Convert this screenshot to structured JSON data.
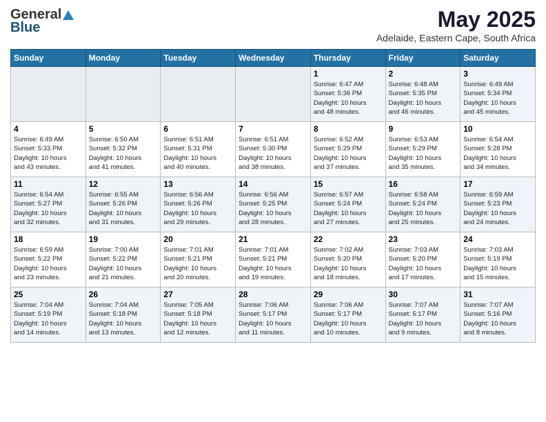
{
  "header": {
    "logo": {
      "general": "General",
      "blue": "Blue",
      "triangle": "▲"
    },
    "title": "May 2025",
    "subtitle": "Adelaide, Eastern Cape, South Africa"
  },
  "weekdays": [
    "Sunday",
    "Monday",
    "Tuesday",
    "Wednesday",
    "Thursday",
    "Friday",
    "Saturday"
  ],
  "weeks": [
    [
      {
        "day": "",
        "info": ""
      },
      {
        "day": "",
        "info": ""
      },
      {
        "day": "",
        "info": ""
      },
      {
        "day": "",
        "info": ""
      },
      {
        "day": "1",
        "info": "Sunrise: 6:47 AM\nSunset: 5:36 PM\nDaylight: 10 hours\nand 48 minutes."
      },
      {
        "day": "2",
        "info": "Sunrise: 6:48 AM\nSunset: 5:35 PM\nDaylight: 10 hours\nand 46 minutes."
      },
      {
        "day": "3",
        "info": "Sunrise: 6:49 AM\nSunset: 5:34 PM\nDaylight: 10 hours\nand 45 minutes."
      }
    ],
    [
      {
        "day": "4",
        "info": "Sunrise: 6:49 AM\nSunset: 5:33 PM\nDaylight: 10 hours\nand 43 minutes."
      },
      {
        "day": "5",
        "info": "Sunrise: 6:50 AM\nSunset: 5:32 PM\nDaylight: 10 hours\nand 41 minutes."
      },
      {
        "day": "6",
        "info": "Sunrise: 6:51 AM\nSunset: 5:31 PM\nDaylight: 10 hours\nand 40 minutes."
      },
      {
        "day": "7",
        "info": "Sunrise: 6:51 AM\nSunset: 5:30 PM\nDaylight: 10 hours\nand 38 minutes."
      },
      {
        "day": "8",
        "info": "Sunrise: 6:52 AM\nSunset: 5:29 PM\nDaylight: 10 hours\nand 37 minutes."
      },
      {
        "day": "9",
        "info": "Sunrise: 6:53 AM\nSunset: 5:29 PM\nDaylight: 10 hours\nand 35 minutes."
      },
      {
        "day": "10",
        "info": "Sunrise: 6:54 AM\nSunset: 5:28 PM\nDaylight: 10 hours\nand 34 minutes."
      }
    ],
    [
      {
        "day": "11",
        "info": "Sunrise: 6:54 AM\nSunset: 5:27 PM\nDaylight: 10 hours\nand 32 minutes."
      },
      {
        "day": "12",
        "info": "Sunrise: 6:55 AM\nSunset: 5:26 PM\nDaylight: 10 hours\nand 31 minutes."
      },
      {
        "day": "13",
        "info": "Sunrise: 6:56 AM\nSunset: 5:26 PM\nDaylight: 10 hours\nand 29 minutes."
      },
      {
        "day": "14",
        "info": "Sunrise: 6:56 AM\nSunset: 5:25 PM\nDaylight: 10 hours\nand 28 minutes."
      },
      {
        "day": "15",
        "info": "Sunrise: 6:57 AM\nSunset: 5:24 PM\nDaylight: 10 hours\nand 27 minutes."
      },
      {
        "day": "16",
        "info": "Sunrise: 6:58 AM\nSunset: 5:24 PM\nDaylight: 10 hours\nand 25 minutes."
      },
      {
        "day": "17",
        "info": "Sunrise: 6:59 AM\nSunset: 5:23 PM\nDaylight: 10 hours\nand 24 minutes."
      }
    ],
    [
      {
        "day": "18",
        "info": "Sunrise: 6:59 AM\nSunset: 5:22 PM\nDaylight: 10 hours\nand 23 minutes."
      },
      {
        "day": "19",
        "info": "Sunrise: 7:00 AM\nSunset: 5:22 PM\nDaylight: 10 hours\nand 21 minutes."
      },
      {
        "day": "20",
        "info": "Sunrise: 7:01 AM\nSunset: 5:21 PM\nDaylight: 10 hours\nand 20 minutes."
      },
      {
        "day": "21",
        "info": "Sunrise: 7:01 AM\nSunset: 5:21 PM\nDaylight: 10 hours\nand 19 minutes."
      },
      {
        "day": "22",
        "info": "Sunrise: 7:02 AM\nSunset: 5:20 PM\nDaylight: 10 hours\nand 18 minutes."
      },
      {
        "day": "23",
        "info": "Sunrise: 7:03 AM\nSunset: 5:20 PM\nDaylight: 10 hours\nand 17 minutes."
      },
      {
        "day": "24",
        "info": "Sunrise: 7:03 AM\nSunset: 5:19 PM\nDaylight: 10 hours\nand 15 minutes."
      }
    ],
    [
      {
        "day": "25",
        "info": "Sunrise: 7:04 AM\nSunset: 5:19 PM\nDaylight: 10 hours\nand 14 minutes."
      },
      {
        "day": "26",
        "info": "Sunrise: 7:04 AM\nSunset: 5:18 PM\nDaylight: 10 hours\nand 13 minutes."
      },
      {
        "day": "27",
        "info": "Sunrise: 7:05 AM\nSunset: 5:18 PM\nDaylight: 10 hours\nand 12 minutes."
      },
      {
        "day": "28",
        "info": "Sunrise: 7:06 AM\nSunset: 5:17 PM\nDaylight: 10 hours\nand 11 minutes."
      },
      {
        "day": "29",
        "info": "Sunrise: 7:06 AM\nSunset: 5:17 PM\nDaylight: 10 hours\nand 10 minutes."
      },
      {
        "day": "30",
        "info": "Sunrise: 7:07 AM\nSunset: 5:17 PM\nDaylight: 10 hours\nand 9 minutes."
      },
      {
        "day": "31",
        "info": "Sunrise: 7:07 AM\nSunset: 5:16 PM\nDaylight: 10 hours\nand 8 minutes."
      }
    ]
  ],
  "colors": {
    "header_bg": "#2471a3",
    "shaded_row": "#f0f4f8"
  }
}
